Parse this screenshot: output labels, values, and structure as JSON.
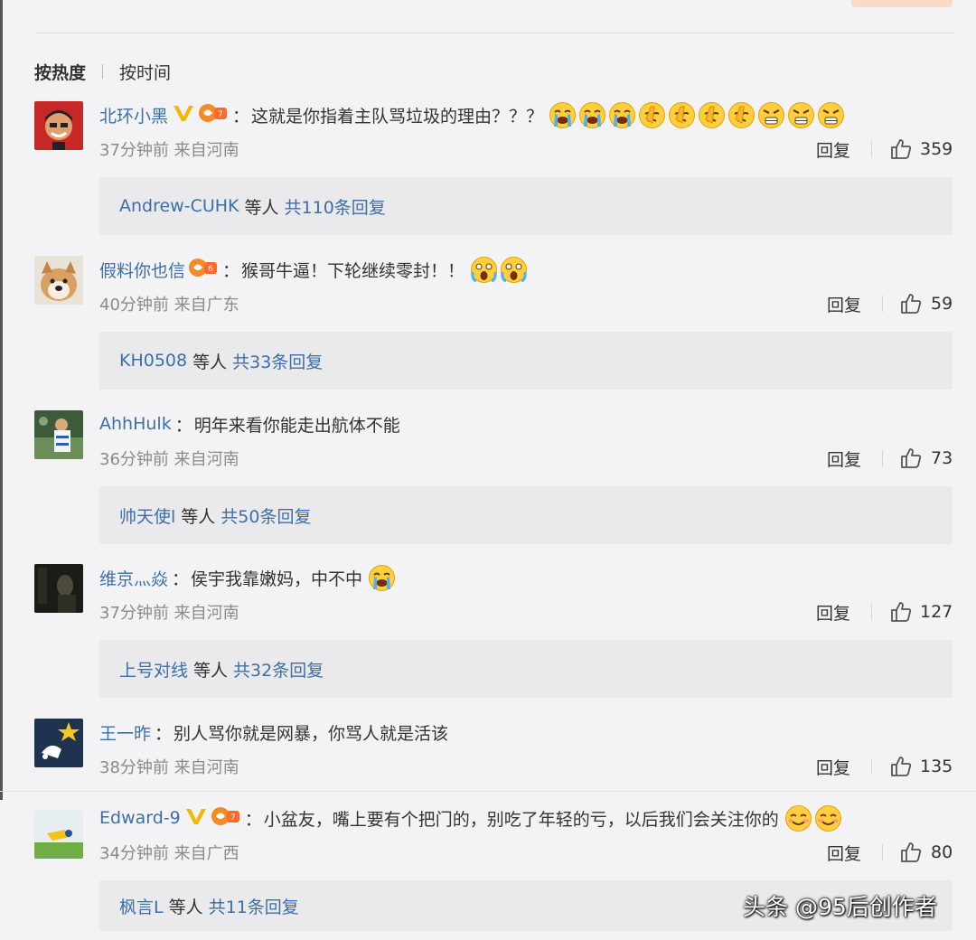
{
  "sort": {
    "hot": "按热度",
    "time": "按时间"
  },
  "ui": {
    "reply_label": "回复",
    "etc_label": "等人"
  },
  "comments": [
    {
      "user": "北环小黑",
      "has_v": true,
      "has_fan": true,
      "text": "这就是你指着主队骂垃圾的理由？？？",
      "emojis": [
        "crying-emoji",
        "crying-emoji",
        "crying-emoji",
        "facepalm-emoji",
        "facepalm-emoji",
        "facepalm-emoji",
        "facepalm-emoji",
        "angry-emoji",
        "angry-emoji",
        "angry-emoji"
      ],
      "meta": "37分钟前 来自河南",
      "likes": "359",
      "reply_user": "Andrew-CUHK",
      "reply_count": "共110条回复"
    },
    {
      "user": "假料你也信",
      "has_v": false,
      "has_fan": true,
      "text": "猴哥牛逼！下轮继续零封！！",
      "emojis": [
        "shocked-emoji",
        "shocked-emoji"
      ],
      "meta": "40分钟前 来自广东",
      "likes": "59",
      "reply_user": "KH0508",
      "reply_count": "共33条回复"
    },
    {
      "user": "AhhHulk",
      "has_v": false,
      "has_fan": false,
      "text": "明年来看你能走出航体不能",
      "emojis": [],
      "meta": "36分钟前 来自河南",
      "likes": "73",
      "reply_user": "帅天使l",
      "reply_count": "共50条回复"
    },
    {
      "user": "维京灬焱",
      "has_v": false,
      "has_fan": false,
      "text": "侯宇我靠嫩妈，中不中",
      "emojis": [
        "crying-emoji"
      ],
      "meta": "37分钟前 来自河南",
      "likes": "127",
      "reply_user": "上号对线",
      "reply_count": "共32条回复"
    },
    {
      "user": "王一昨",
      "has_v": false,
      "has_fan": false,
      "text": "别人骂你就是网暴，你骂人就是活该",
      "emojis": [],
      "meta": "38分钟前 来自河南",
      "likes": "135",
      "reply_user": null,
      "reply_count": null
    },
    {
      "user": "Edward-9",
      "has_v": true,
      "has_fan": true,
      "text": "小盆友，嘴上要有个把门的，别吃了年轻的亏，以后我们会关注你的",
      "emojis": [
        "smile-emoji",
        "smile-emoji"
      ],
      "meta": "34分钟前 来自广西",
      "likes": "80",
      "reply_user": "枫言L",
      "reply_count": "共11条回复"
    }
  ],
  "watermark": "头条 @95后创作者"
}
